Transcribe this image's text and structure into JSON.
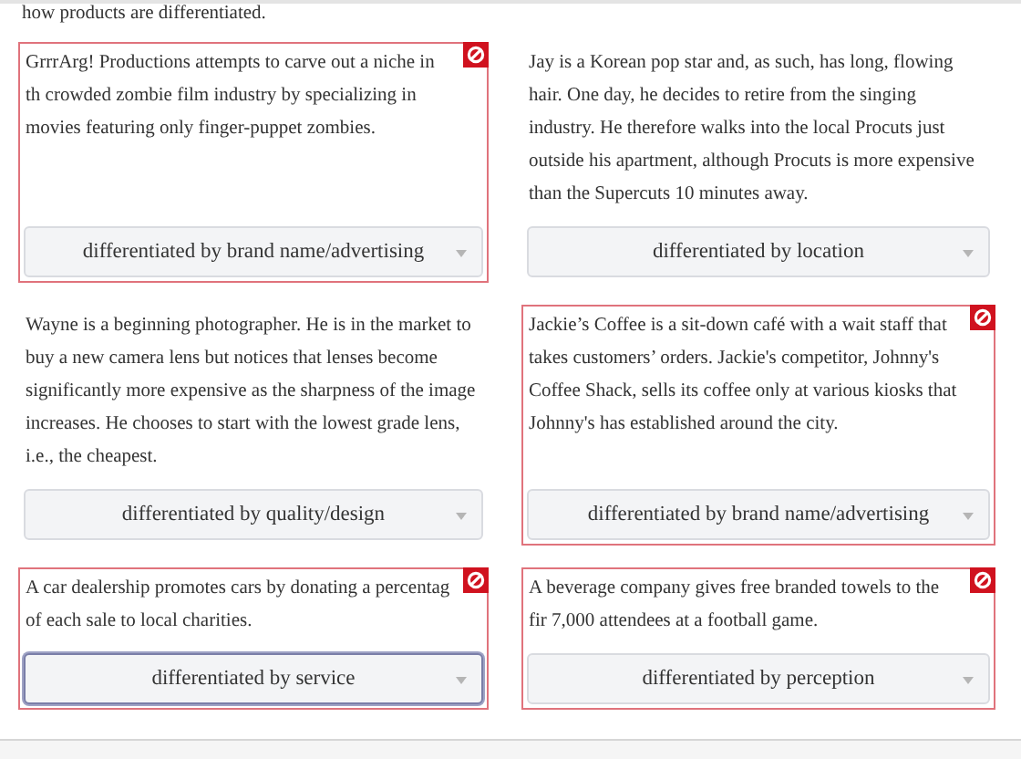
{
  "intro": "how products are differentiated.",
  "items": [
    {
      "text": "GrrrArg! Productions attempts to carve out a niche in th crowded zombie film industry by specializing in movies featuring only finger-puppet zombies.",
      "answer": "differentiated by brand name/advertising",
      "incorrect": true,
      "focused": false
    },
    {
      "text": "Jay is a Korean pop star and, as such, has long, flowing hair. One day, he decides to retire from the singing industry. He therefore walks into the local Procuts just outside his apartment, although Procuts is more expensive than the Supercuts 10 minutes away.",
      "answer": "differentiated by location",
      "incorrect": false,
      "focused": false
    },
    {
      "text": "Wayne is a beginning photographer. He is in the market to buy a new camera lens but notices that lenses become significantly more expensive as the sharpness of the image increases. He chooses to start with the lowest grade lens, i.e., the cheapest.",
      "answer": "differentiated by quality/design",
      "incorrect": false,
      "focused": false
    },
    {
      "text": "Jackie’s Coffee is a sit-down café with a wait staff that takes customers’ orders. Jackie's competitor, Johnny's Coffee Shack, sells its coffee only at various kiosks that Johnny's has established around the city.",
      "answer": "differentiated by brand name/advertising",
      "incorrect": true,
      "focused": false
    },
    {
      "text": "A car dealership promotes cars by donating a percentag of each sale to local charities.",
      "answer": "differentiated by service",
      "incorrect": true,
      "focused": true
    },
    {
      "text": "A beverage company gives free branded towels to the fir 7,000 attendees at a football game.",
      "answer": "differentiated by perception",
      "incorrect": true,
      "focused": false
    }
  ]
}
